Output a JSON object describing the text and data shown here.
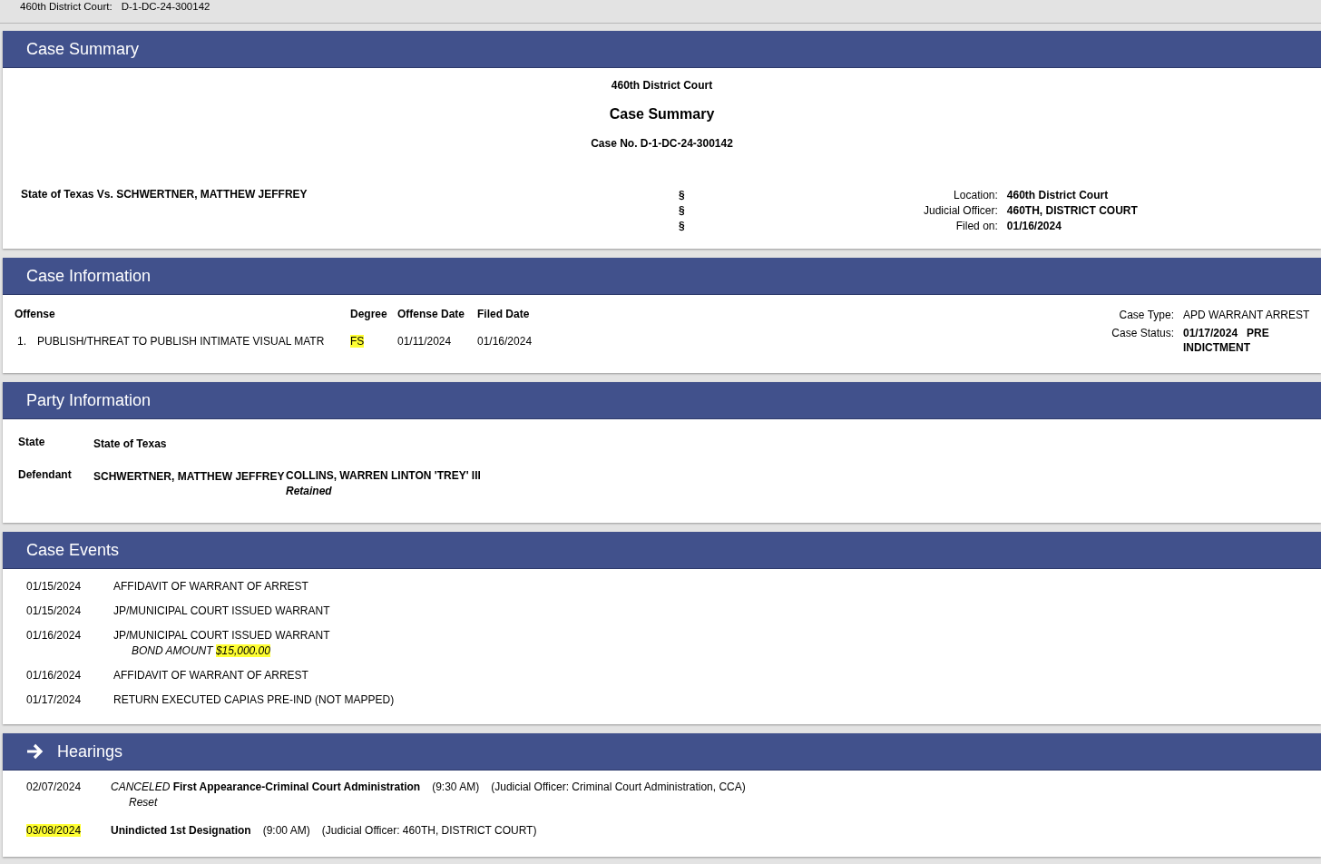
{
  "top_bar": {
    "label": "460th District Court:",
    "case_number": "D-1-DC-24-300142"
  },
  "case_summary": {
    "title": "Case Summary",
    "court": "460th District Court",
    "heading": "Case Summary",
    "case_no": "Case No. D-1-DC-24-300142",
    "style": "State of Texas Vs. SCHWERTNER, MATTHEW JEFFREY",
    "section_marks": [
      "§",
      "§",
      "§"
    ],
    "details": [
      {
        "label": "Location:",
        "value": "460th District Court"
      },
      {
        "label": "Judicial Officer:",
        "value": "460TH, DISTRICT COURT"
      },
      {
        "label": "Filed on:",
        "value": "01/16/2024"
      }
    ]
  },
  "case_information": {
    "title": "Case Information",
    "columns": [
      "Offense",
      "Degree",
      "Offense Date",
      "Filed Date"
    ],
    "offenses": [
      {
        "number": "1.",
        "offense": "PUBLISH/THREAT TO PUBLISH INTIMATE VISUAL MATR",
        "degree": "FS",
        "degree_highlighted": true,
        "offense_date": "01/11/2024",
        "filed_date": "01/16/2024"
      }
    ],
    "details": [
      {
        "label": "Case Type:",
        "value": "APD WARRANT ARREST",
        "bold": false
      },
      {
        "label": "Case Status:",
        "value": "01/17/2024   PRE INDICTMENT",
        "bold": true
      }
    ]
  },
  "party_information": {
    "title": "Party Information",
    "parties": [
      {
        "role": "State",
        "name": "State of Texas"
      },
      {
        "role": "Defendant",
        "name": "SCHWERTNER, MATTHEW JEFFREY",
        "attorney": "COLLINS, WARREN LINTON 'TREY' III",
        "attorney_status": "Retained"
      }
    ]
  },
  "case_events": {
    "title": "Case Events",
    "events": [
      {
        "date": "01/15/2024",
        "description": "AFFIDAVIT OF WARRANT OF ARREST"
      },
      {
        "date": "01/15/2024",
        "description": "JP/MUNICIPAL COURT ISSUED WARRANT"
      },
      {
        "date": "01/16/2024",
        "description": "JP/MUNICIPAL COURT ISSUED WARRANT",
        "bond_label": "BOND AMOUNT",
        "bond_amount": "$15,000.00",
        "bond_highlighted": true
      },
      {
        "date": "01/16/2024",
        "description": "AFFIDAVIT OF WARRANT OF ARREST"
      },
      {
        "date": "01/17/2024",
        "description": "RETURN EXECUTED CAPIAS PRE-IND (NOT MAPPED)"
      }
    ]
  },
  "hearings": {
    "title": "Hearings",
    "items": [
      {
        "date": "02/07/2024",
        "date_highlighted": false,
        "status": "CANCELED",
        "title": "First Appearance-Criminal Court Administration",
        "time": "(9:30 AM)",
        "officer": "(Judicial Officer: Criminal Court Administration, CCA)",
        "note": "Reset"
      },
      {
        "date": "03/08/2024",
        "date_highlighted": true,
        "title": "Unindicted 1st Designation",
        "time": "(9:00 AM)",
        "officer": "(Judicial Officer: 460TH, DISTRICT COURT)"
      }
    ]
  }
}
